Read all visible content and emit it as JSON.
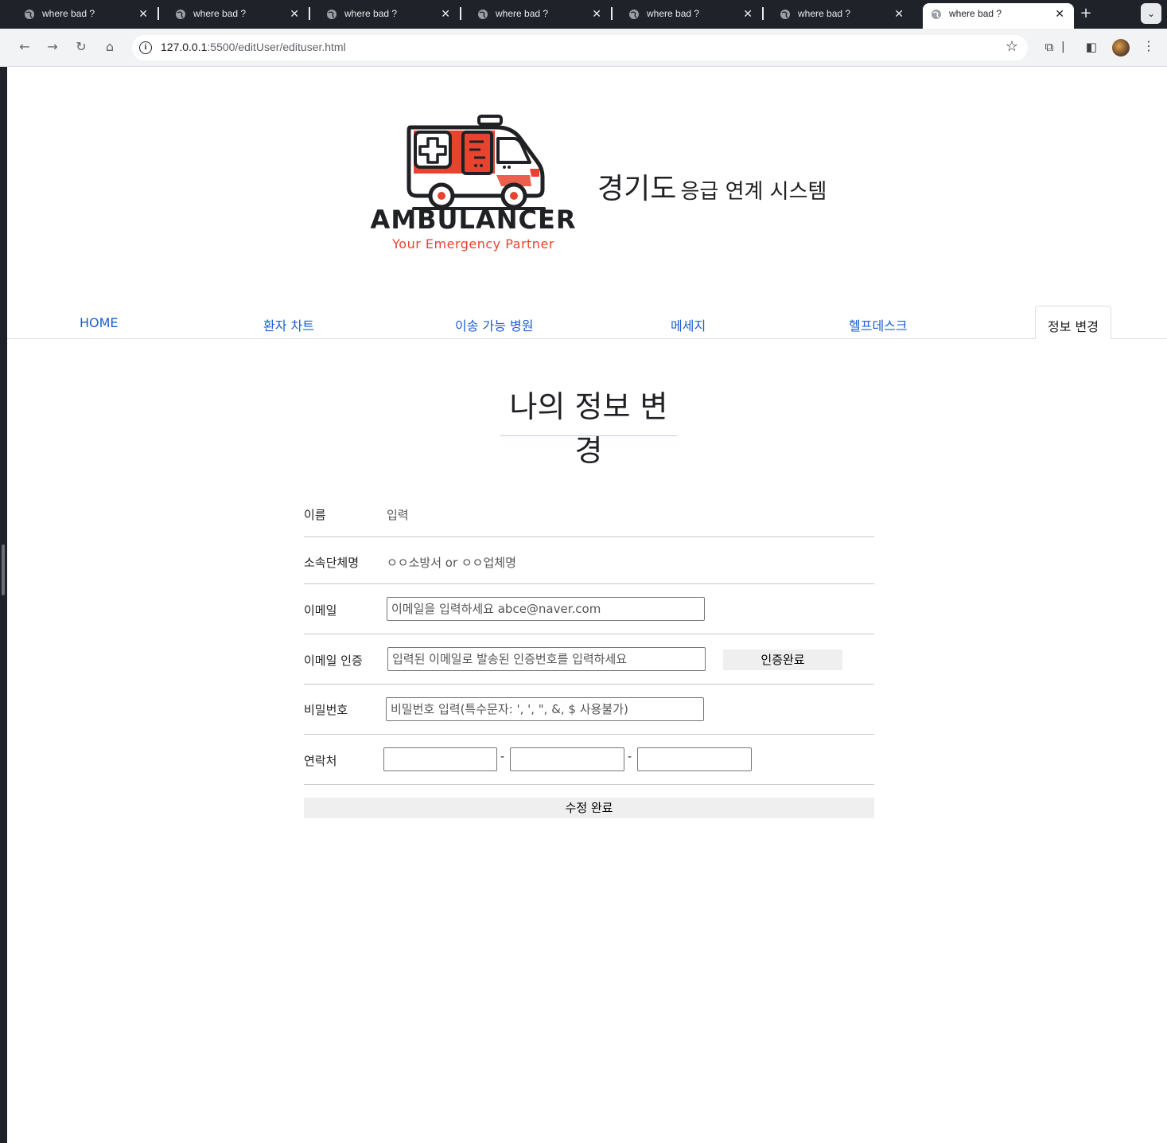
{
  "browser": {
    "tabs": [
      {
        "title": "where bad ?"
      },
      {
        "title": "where bad ?"
      },
      {
        "title": "where bad ?"
      },
      {
        "title": "where bad ?"
      },
      {
        "title": "where bad ?"
      },
      {
        "title": "where bad ?"
      },
      {
        "title": "where bad ?",
        "active": true
      }
    ],
    "url_host": "127.0.0.1",
    "url_rest": ":5500/editUser/edituser.html"
  },
  "header": {
    "brand": "AMBULANCER",
    "tagline": "Your Emergency Partner",
    "title_big": "경기도",
    "title_small": "응급 연계 시스템"
  },
  "nav": {
    "items": [
      "HOME",
      "환자 차트",
      "이송 가능 병원",
      "메세지",
      "헬프데스크",
      "정보 변경"
    ],
    "active": "정보 변경"
  },
  "page_heading": "나의 정보 변경",
  "form": {
    "name_label": "이름",
    "name_value": "입력",
    "org_label": "소속단체명",
    "org_value": "ㅇㅇ소방서 or ㅇㅇ업체명",
    "email_label": "이메일",
    "email_placeholder": "이메일을 입력하세요 abce@naver.com",
    "verify_label": "이메일 인증",
    "verify_placeholder": "입력된 이메일로 발송된 인증번호를 입력하세요",
    "verify_button": "인증완료",
    "password_label": "비밀번호",
    "password_placeholder": "비밀번호 입력(특수문자: ', ', \", &, $ 사용불가)",
    "phone_label": "연락처",
    "phone_sep": "-",
    "submit": "수정 완료"
  },
  "colors": {
    "accent_red": "#e8432f",
    "nav_link": "#1a5fd1"
  }
}
